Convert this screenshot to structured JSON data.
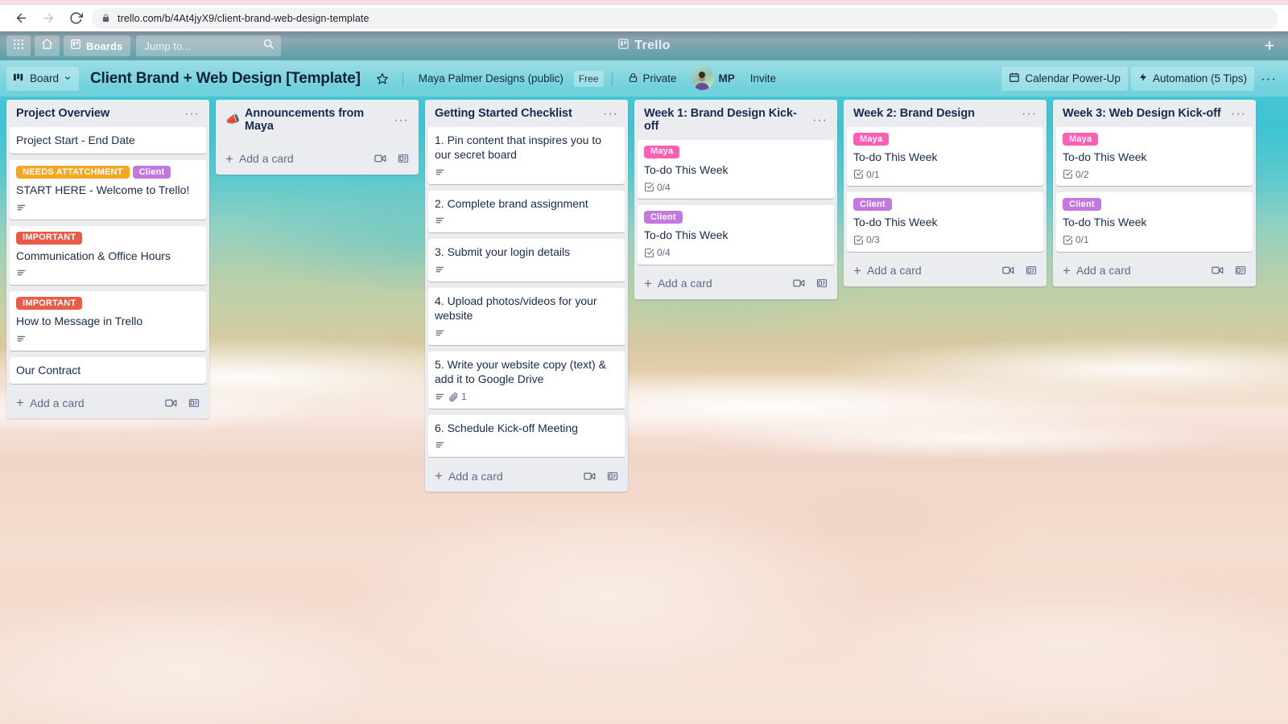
{
  "browser": {
    "back_icon": "back-arrow-icon",
    "forward_icon": "forward-arrow-icon",
    "reload_icon": "reload-icon",
    "lock_icon": "lock-icon",
    "url": "trello.com/b/4At4jyX9/client-brand-web-design-template"
  },
  "topnav": {
    "apps_icon": "grid-apps-icon",
    "home_icon": "home-icon",
    "boards_icon": "boards-icon",
    "boards_label": "Boards",
    "search_placeholder": "Jump to...",
    "search_icon": "search-icon",
    "logo_icon": "trello-logo-icon",
    "logo_label": "Trello",
    "plus_label": "+"
  },
  "boardbar": {
    "view_icon": "board-view-icon",
    "view_label": "Board",
    "chevron_icon": "chevron-down-icon",
    "title": "Client Brand + Web Design [Template]",
    "star_icon": "star-icon",
    "workspace": "Maya Palmer Designs (public)",
    "plan_badge": "Free",
    "privacy_icon": "lock-icon",
    "privacy_label": "Private",
    "avatar_name": "avatar",
    "member_initials": "MP",
    "invite_label": "Invite",
    "calendar_icon": "calendar-icon",
    "calendar_label": "Calendar Power-Up",
    "automation_icon": "bolt-icon",
    "automation_label": "Automation (5 Tips)",
    "more_label": "···"
  },
  "common": {
    "add_card_label": "Add a card",
    "list_menu_label": "···",
    "template_icon": "card-template-icon",
    "video_icon": "video-camera-icon",
    "description_icon": "description-icon",
    "attachment_icon": "attachment-icon",
    "checklist_icon": "checklist-icon"
  },
  "label_colors": {
    "needs_attachment": "#f5a623",
    "client": "#c377e0",
    "important": "#eb5a46",
    "maya": "#ff5eb3"
  },
  "lists": [
    {
      "title": "Project Overview",
      "emoji": "",
      "cards": [
        {
          "labels": [],
          "title": "Project Start - End Date",
          "badges": []
        },
        {
          "labels": [
            {
              "text": "NEEDS ATTATCHMENT",
              "color": "#f5a623"
            },
            {
              "text": "Client",
              "color": "#c377e0"
            }
          ],
          "title": "START HERE - Welcome to Trello!",
          "badges": [
            {
              "type": "description",
              "value": ""
            }
          ]
        },
        {
          "labels": [
            {
              "text": "IMPORTANT",
              "color": "#eb5a46"
            }
          ],
          "title": "Communication & Office Hours",
          "badges": [
            {
              "type": "description",
              "value": ""
            }
          ]
        },
        {
          "labels": [
            {
              "text": "IMPORTANT",
              "color": "#eb5a46"
            }
          ],
          "title": "How to Message in Trello",
          "badges": [
            {
              "type": "description",
              "value": ""
            }
          ]
        },
        {
          "labels": [],
          "title": "Our Contract",
          "badges": []
        }
      ]
    },
    {
      "title": "Announcements from Maya",
      "emoji": "📣",
      "cards": []
    },
    {
      "title": "Getting Started Checklist",
      "emoji": "",
      "cards": [
        {
          "labels": [],
          "title": "1. Pin content that inspires you to our secret board",
          "badges": [
            {
              "type": "description",
              "value": ""
            }
          ]
        },
        {
          "labels": [],
          "title": "2. Complete brand assignment",
          "badges": [
            {
              "type": "description",
              "value": ""
            }
          ]
        },
        {
          "labels": [],
          "title": "3. Submit your login details",
          "badges": [
            {
              "type": "description",
              "value": ""
            }
          ]
        },
        {
          "labels": [],
          "title": "4. Upload photos/videos for your website",
          "badges": [
            {
              "type": "description",
              "value": ""
            }
          ]
        },
        {
          "labels": [],
          "title": "5. Write your website copy (text) & add it to Google Drive",
          "badges": [
            {
              "type": "description",
              "value": ""
            },
            {
              "type": "attachment",
              "value": "1"
            }
          ]
        },
        {
          "labels": [],
          "title": "6. Schedule Kick-off Meeting",
          "badges": [
            {
              "type": "description",
              "value": ""
            }
          ]
        }
      ]
    },
    {
      "title": "Week 1: Brand Design Kick-off",
      "emoji": "",
      "cards": [
        {
          "labels": [
            {
              "text": "Maya",
              "color": "#ff5eb3"
            }
          ],
          "title": "To-do This Week",
          "badges": [
            {
              "type": "checklist",
              "value": "0/4"
            }
          ]
        },
        {
          "labels": [
            {
              "text": "Client",
              "color": "#c377e0"
            }
          ],
          "title": "To-do This Week",
          "badges": [
            {
              "type": "checklist",
              "value": "0/4"
            }
          ]
        }
      ]
    },
    {
      "title": "Week 2: Brand Design",
      "emoji": "",
      "cards": [
        {
          "labels": [
            {
              "text": "Maya",
              "color": "#ff5eb3"
            }
          ],
          "title": "To-do This Week",
          "badges": [
            {
              "type": "checklist",
              "value": "0/1"
            }
          ]
        },
        {
          "labels": [
            {
              "text": "Client",
              "color": "#c377e0"
            }
          ],
          "title": "To-do This Week",
          "badges": [
            {
              "type": "checklist",
              "value": "0/3"
            }
          ]
        }
      ]
    },
    {
      "title": "Week 3: Web Design Kick-off",
      "emoji": "",
      "cards": [
        {
          "labels": [
            {
              "text": "Maya",
              "color": "#ff5eb3"
            }
          ],
          "title": "To-do This Week",
          "badges": [
            {
              "type": "checklist",
              "value": "0/2"
            }
          ]
        },
        {
          "labels": [
            {
              "text": "Client",
              "color": "#c377e0"
            }
          ],
          "title": "To-do This Week",
          "badges": [
            {
              "type": "checklist",
              "value": "0/1"
            }
          ]
        }
      ]
    }
  ]
}
